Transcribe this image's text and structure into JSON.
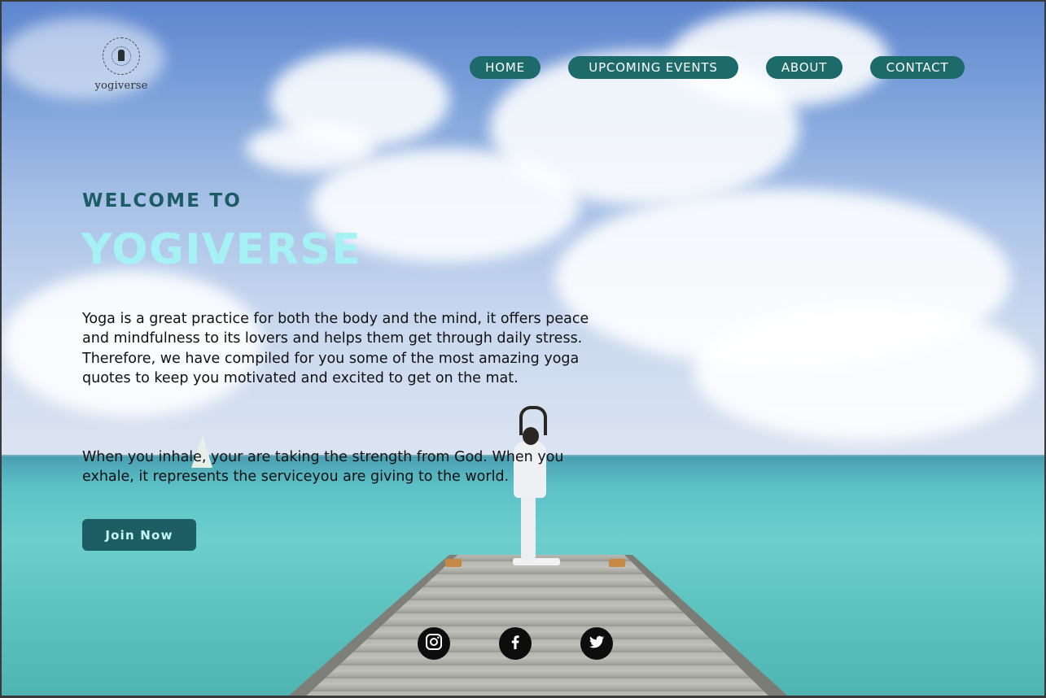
{
  "brand": {
    "logo_text": "yogiverse"
  },
  "nav": {
    "items": [
      {
        "label": "HOME"
      },
      {
        "label": "UPCOMING EVENTS"
      },
      {
        "label": "ABOUT"
      },
      {
        "label": "CONTACT"
      }
    ],
    "color": "#1c6a6a"
  },
  "hero": {
    "welcome": "WELCOME TO",
    "title": "YOGIVERSE",
    "intro": "Yoga is a great practice for both the body and the mind, it offers peace and mindfulness to its lovers and helps them get through daily stress. Therefore, we have compiled for you some of the most amazing yoga quotes to keep you motivated and excited to get on the mat.",
    "quote": "When you inhale, your are taking the strength from God. When you exhale, it represents the serviceyou are giving to the world.",
    "join_label": "Join Now",
    "title_color": "#a6f1f4",
    "accent_color": "#1c5c63"
  },
  "social": {
    "icons": [
      "instagram-icon",
      "facebook-icon",
      "twitter-icon"
    ]
  }
}
